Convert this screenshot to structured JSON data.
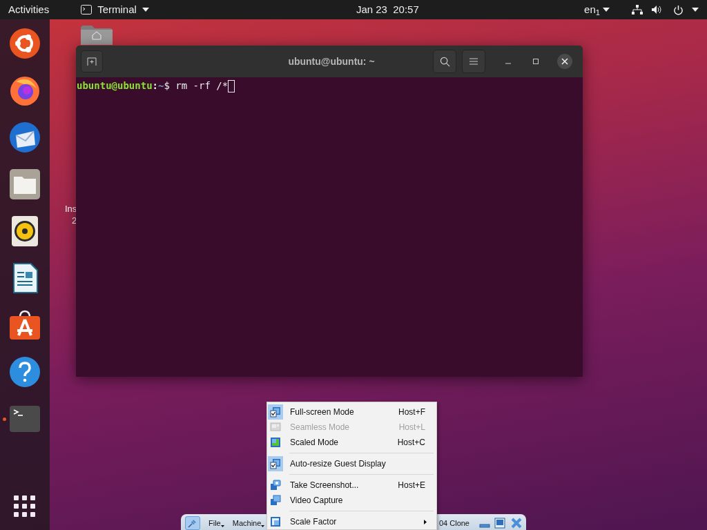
{
  "top_bar": {
    "activities": "Activities",
    "app_menu": "Terminal",
    "clock": "Jan 23  20:57",
    "input_source": "en$_{1}$"
  },
  "dock": {
    "apps": [
      {
        "kind": "ubuntu",
        "running": false
      },
      {
        "kind": "firefox",
        "running": false
      },
      {
        "kind": "thunderbird",
        "running": false
      },
      {
        "kind": "files",
        "running": false
      },
      {
        "kind": "rhythmbox",
        "running": false
      },
      {
        "kind": "writer",
        "running": false
      },
      {
        "kind": "software",
        "running": false
      },
      {
        "kind": "help",
        "running": false
      },
      {
        "kind": "terminal",
        "running": true
      }
    ]
  },
  "desktop": {
    "items": [
      {
        "label_line_1": "Ins",
        "label_line_2": "2"
      }
    ]
  },
  "terminal": {
    "title": "ubuntu@ubuntu: ~",
    "line": {
      "user": "ubuntu@ubuntu",
      "separator": ":",
      "path": "~",
      "command": "$ rm -rf /*"
    }
  },
  "view_menu": {
    "items": [
      {
        "kind": "item",
        "label": "Full-screen Mode",
        "shortcut": "Host+F",
        "checked": true,
        "disabled": false,
        "submenu": false
      },
      {
        "kind": "item",
        "label": "Seamless Mode",
        "shortcut": "Host+L",
        "checked": false,
        "disabled": true,
        "submenu": false
      },
      {
        "kind": "item",
        "label": "Scaled Mode",
        "shortcut": "Host+C",
        "checked": false,
        "disabled": false,
        "submenu": false
      },
      {
        "kind": "separator"
      },
      {
        "kind": "item",
        "label": "Auto-resize Guest Display",
        "checked": true,
        "disabled": false,
        "submenu": false
      },
      {
        "kind": "separator"
      },
      {
        "kind": "item",
        "label": "Take Screenshot...",
        "shortcut": "Host+E",
        "checked": false,
        "disabled": false,
        "submenu": false
      },
      {
        "kind": "item",
        "label": "Video Capture",
        "checked": false,
        "disabled": false,
        "submenu": false
      },
      {
        "kind": "separator"
      },
      {
        "kind": "item",
        "label": "Scale Factor",
        "checked": false,
        "disabled": false,
        "submenu": true
      }
    ]
  },
  "vm_toolbar": {
    "menus": [
      "File",
      "Machine"
    ],
    "title": "04 Clone"
  }
}
